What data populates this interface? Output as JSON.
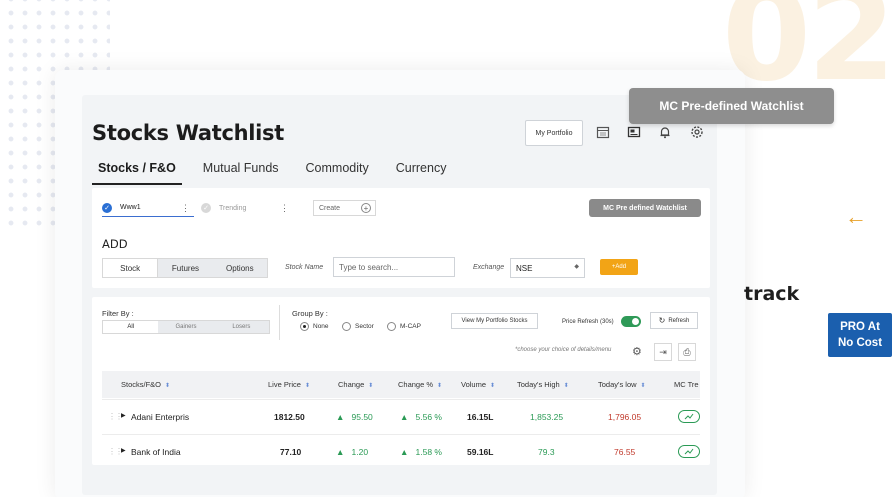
{
  "background_number": "02",
  "header": {
    "title": "Stocks Watchlist",
    "portfolio_button": "My Portfolio"
  },
  "tabs": [
    "Stocks / F&O",
    "Mutual Funds",
    "Commodity",
    "Currency"
  ],
  "watchlist_tabs": {
    "first": "Www1",
    "second": "Trending",
    "create": "Create"
  },
  "mc_predefined_button": "MC Pre defined Watchlist",
  "add": {
    "label": "ADD",
    "segments": [
      "Stock",
      "Futures",
      "Options"
    ],
    "stock_name_label": "Stock Name",
    "search_placeholder": "Type to search...",
    "exchange_label": "Exchange",
    "exchange_value": "NSE",
    "add_button": "+Add"
  },
  "filter": {
    "label": "Filter By :",
    "options": [
      "All",
      "Gainers",
      "Losers"
    ]
  },
  "group": {
    "label": "Group By :",
    "options": [
      "None",
      "Sector",
      "M-CAP"
    ]
  },
  "view_portfolio_button": "View My Portfolio Stocks",
  "price_refresh_label": "Price Refresh (30s)",
  "refresh_button": "Refresh",
  "details_hint": "*choose your choice of details/menu",
  "table": {
    "headers": [
      "Stocks/F&O",
      "Live Price",
      "Change",
      "Change %",
      "Volume",
      "Today's High",
      "Today's low",
      "MC Tre"
    ],
    "rows": [
      {
        "name": "Adani Enterpris",
        "price": "1812.50",
        "change": "95.50",
        "change_pct": "5.56 %",
        "volume": "16.15L",
        "high": "1,853.25",
        "low": "1,796.05"
      },
      {
        "name": "Bank of India",
        "price": "77.10",
        "change": "1.20",
        "change_pct": "1.58 %",
        "volume": "59.16L",
        "high": "79.3",
        "low": "76.55"
      }
    ]
  },
  "overlay": {
    "tooltip": "MC Pre-defined Watchlist",
    "arrow": "←",
    "track_word": "track",
    "pro_line1": "PRO At",
    "pro_line2": "No Cost"
  },
  "icons": {
    "header": [
      "calendar-icon",
      "news-icon",
      "bell-icon",
      "settings-icon"
    ],
    "accent": "#f2a416",
    "brand_blue": "#1b5fae",
    "positive": "#2a9a55",
    "negative": "#c0392b"
  }
}
